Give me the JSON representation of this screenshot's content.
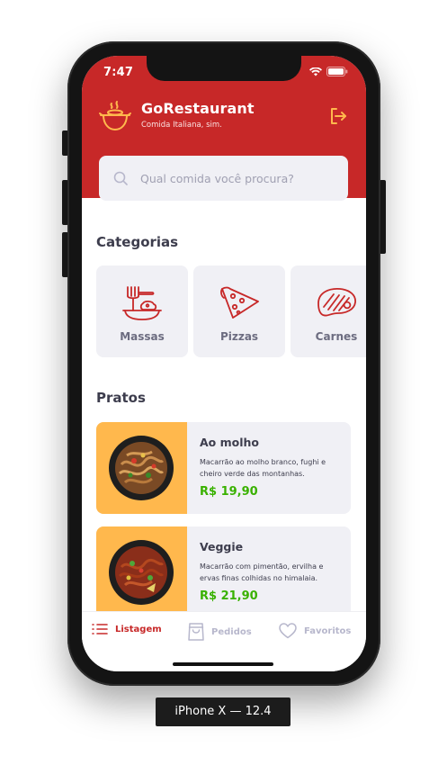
{
  "status_bar": {
    "time": "7:47"
  },
  "header": {
    "brand_name": "GoRestaurant",
    "tagline": "Comida Italiana, sim.",
    "icons": {
      "logo": "cooking-pot-icon",
      "logout": "logout-icon"
    }
  },
  "search": {
    "placeholder": "Qual comida você procura?",
    "value": "",
    "icon": "search-icon"
  },
  "categories": {
    "title": "Categorias",
    "items": [
      {
        "label": "Massas",
        "icon": "pasta-icon"
      },
      {
        "label": "Pizzas",
        "icon": "pizza-icon"
      },
      {
        "label": "Carnes",
        "icon": "steak-icon"
      }
    ]
  },
  "dishes": {
    "title": "Pratos",
    "items": [
      {
        "name": "Ao molho",
        "description": "Macarrão ao molho branco, fughi e cheiro verde das montanhas.",
        "price": "R$ 19,90"
      },
      {
        "name": "Veggie",
        "description": "Macarrão com pimentão, ervilha e ervas finas colhidas no himalaia.",
        "price": "R$ 21,90"
      }
    ]
  },
  "tab_bar": {
    "items": [
      {
        "label": "Listagem",
        "icon": "list-icon",
        "active": true
      },
      {
        "label": "Pedidos",
        "icon": "shopping-bag-icon",
        "active": false
      },
      {
        "label": "Favoritos",
        "icon": "heart-icon",
        "active": false
      }
    ]
  },
  "device_caption": "iPhone X — 12.4",
  "colors": {
    "brand_red": "#c72828",
    "price_green": "#39b100",
    "dish_image_bg": "#ffb84d",
    "card_bg": "#f0f0f5"
  }
}
